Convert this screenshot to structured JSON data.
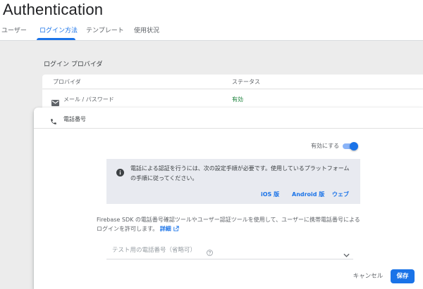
{
  "header": {
    "title": "Authentication",
    "tabs": [
      {
        "label": "ユーザー"
      },
      {
        "label": "ログイン方法"
      },
      {
        "label": "テンプレート"
      },
      {
        "label": "使用状況"
      }
    ],
    "active_tab": "ログイン方法"
  },
  "providers": {
    "section_title": "ログイン プロバイダ",
    "columns": [
      "プロバイダ",
      "ステータス"
    ],
    "rows": [
      {
        "name": "メール / パスワード",
        "status": "有効",
        "icon": "mail-icon"
      }
    ]
  },
  "phone_panel": {
    "title": "電話番号",
    "icon": "phone-icon",
    "enable_label": "有効にする",
    "enabled": true,
    "notice": {
      "text": "電話による認証を行うには、次の設定手順が必要です。使用しているプラットフォームの手順に従ってください。",
      "links": [
        "iOS 版",
        "Android 版",
        "ウェブ"
      ]
    },
    "description": "Firebase SDK の電話番号確認ツールやユーザー認証ツールを使用して、ユーザーに携帯電話番号によるログインを許可します。",
    "details_link": "詳細",
    "test_numbers_label": "テスト用の電話番号（省略可）",
    "cancel_label": "キャンセル",
    "save_label": "保存"
  },
  "colors": {
    "accent": "#1a73e8",
    "status_enabled": "#188038",
    "notice_bg": "#e8eaf0"
  }
}
